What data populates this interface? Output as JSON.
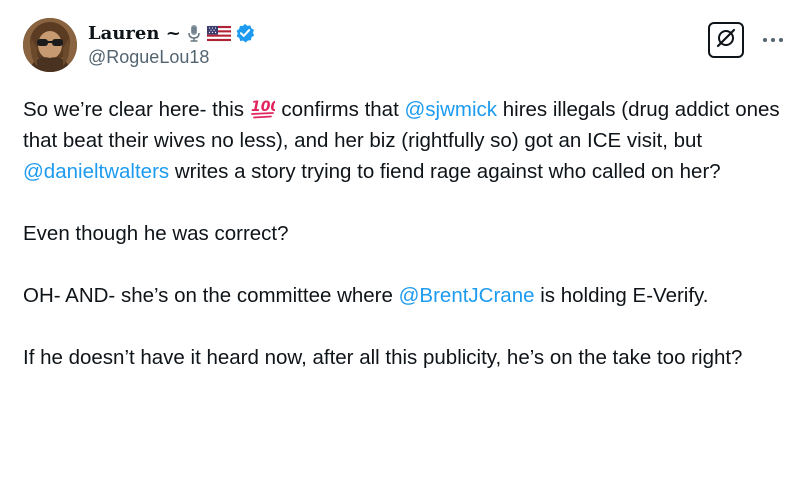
{
  "author": {
    "display_name": "Lauren ~",
    "handle": "@RogueLou18",
    "name_icons": [
      "microphone-icon",
      "us-flag-icon"
    ],
    "verified_icon": "verified-badge-icon",
    "verified_color": "#1d9bf0"
  },
  "actions": {
    "grok_icon": "grok-icon",
    "more_icon": "more-icon"
  },
  "post": {
    "p1_a": "So we’re clear here- this ",
    "p1_emoji": "hundred-points-emoji",
    "p1_b": " confirms that ",
    "p1_mention1": "@sjwmick",
    "p1_c": " hires illegals (drug addict ones that beat their wives no less), and her biz (rightfully so) got an ICE visit, but ",
    "p1_mention2": "@danieltwalters",
    "p1_d": " writes a story trying to fiend rage against who called on her?",
    "p2": "Even though he was correct?",
    "p3_a": "OH- AND- she’s on the committee where ",
    "p3_mention": "@BrentJCrane",
    "p3_b": " is holding E-Verify.",
    "p4": "If he doesn’t have it heard now, after all this publicity, he’s on the take too right?"
  },
  "colors": {
    "text": "#0f1419",
    "secondary": "#536471",
    "link": "#1d9bf0",
    "emoji_red": "#e0245e"
  }
}
